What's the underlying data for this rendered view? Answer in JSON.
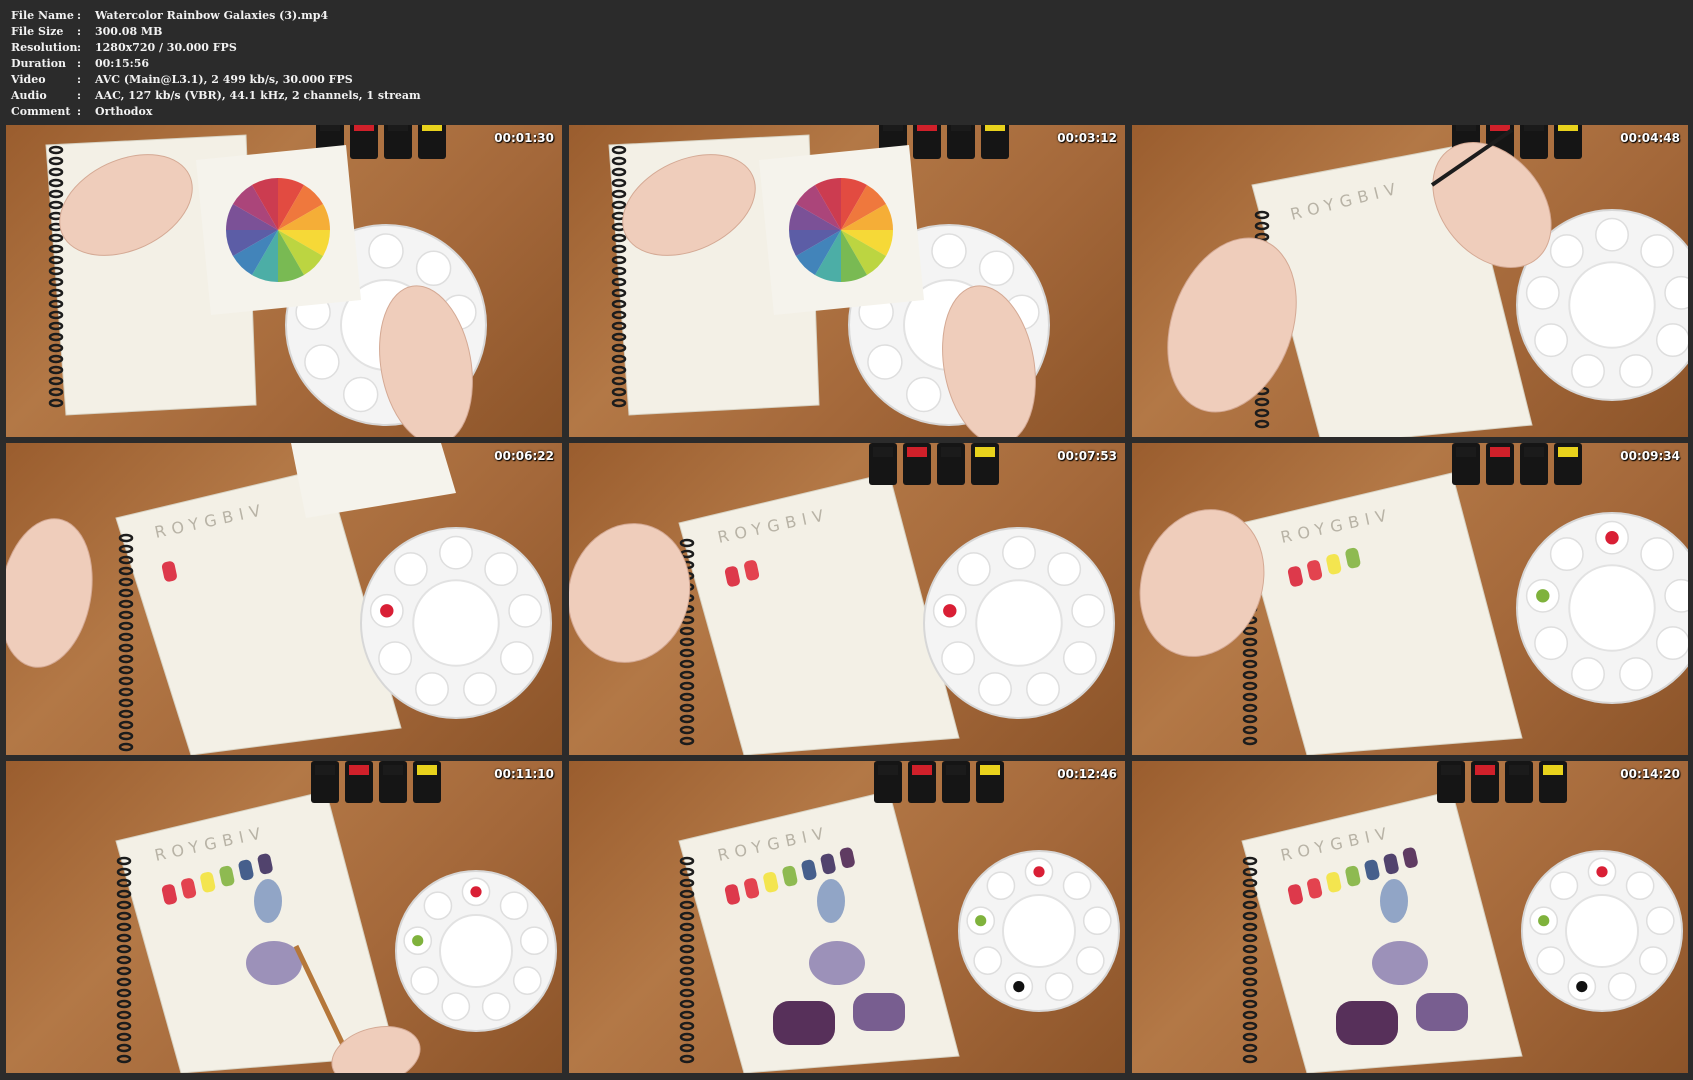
{
  "file_info": [
    {
      "label": "File Name",
      "value": "Watercolor Rainbow Galaxies (3).mp4"
    },
    {
      "label": "File Size",
      "value": "300.08 MB"
    },
    {
      "label": "Resolution",
      "value": "1280x720 / 30.000 FPS"
    },
    {
      "label": "Duration",
      "value": "00:15:56"
    },
    {
      "label": "Video",
      "value": "AVC (Main@L3.1), 2 499 kb/s, 30.000 FPS"
    },
    {
      "label": "Audio",
      "value": "AAC, 127 kb/s (VBR), 44.1 kHz, 2 channels, 1 stream"
    },
    {
      "label": "Comment",
      "value": "Orthodox"
    }
  ],
  "separator": ":",
  "thumbnails": [
    {
      "timestamp": "00:01:30",
      "scene": "color-wheel-card"
    },
    {
      "timestamp": "00:03:12",
      "scene": "color-wheel-card"
    },
    {
      "timestamp": "00:04:48",
      "scene": "sketchbook-writing"
    },
    {
      "timestamp": "00:06:22",
      "scene": "sketchbook-one-swatch"
    },
    {
      "timestamp": "00:07:53",
      "scene": "sketchbook-two-swatches"
    },
    {
      "timestamp": "00:09:34",
      "scene": "sketchbook-four-swatches"
    },
    {
      "timestamp": "00:11:10",
      "scene": "sketchbook-painting"
    },
    {
      "timestamp": "00:12:46",
      "scene": "sketchbook-finished"
    },
    {
      "timestamp": "00:14:20",
      "scene": "sketchbook-finished"
    }
  ],
  "colors": {
    "background": "#2b2b2b",
    "table": "#a4683a",
    "paper": "#f3f0e6",
    "palette": "#f4f4f4",
    "swatches": [
      "#d91f35",
      "#e02a3a",
      "#f2e23a",
      "#7fb23c",
      "#2d4a80",
      "#3a2a5c",
      "#4a2150"
    ]
  }
}
